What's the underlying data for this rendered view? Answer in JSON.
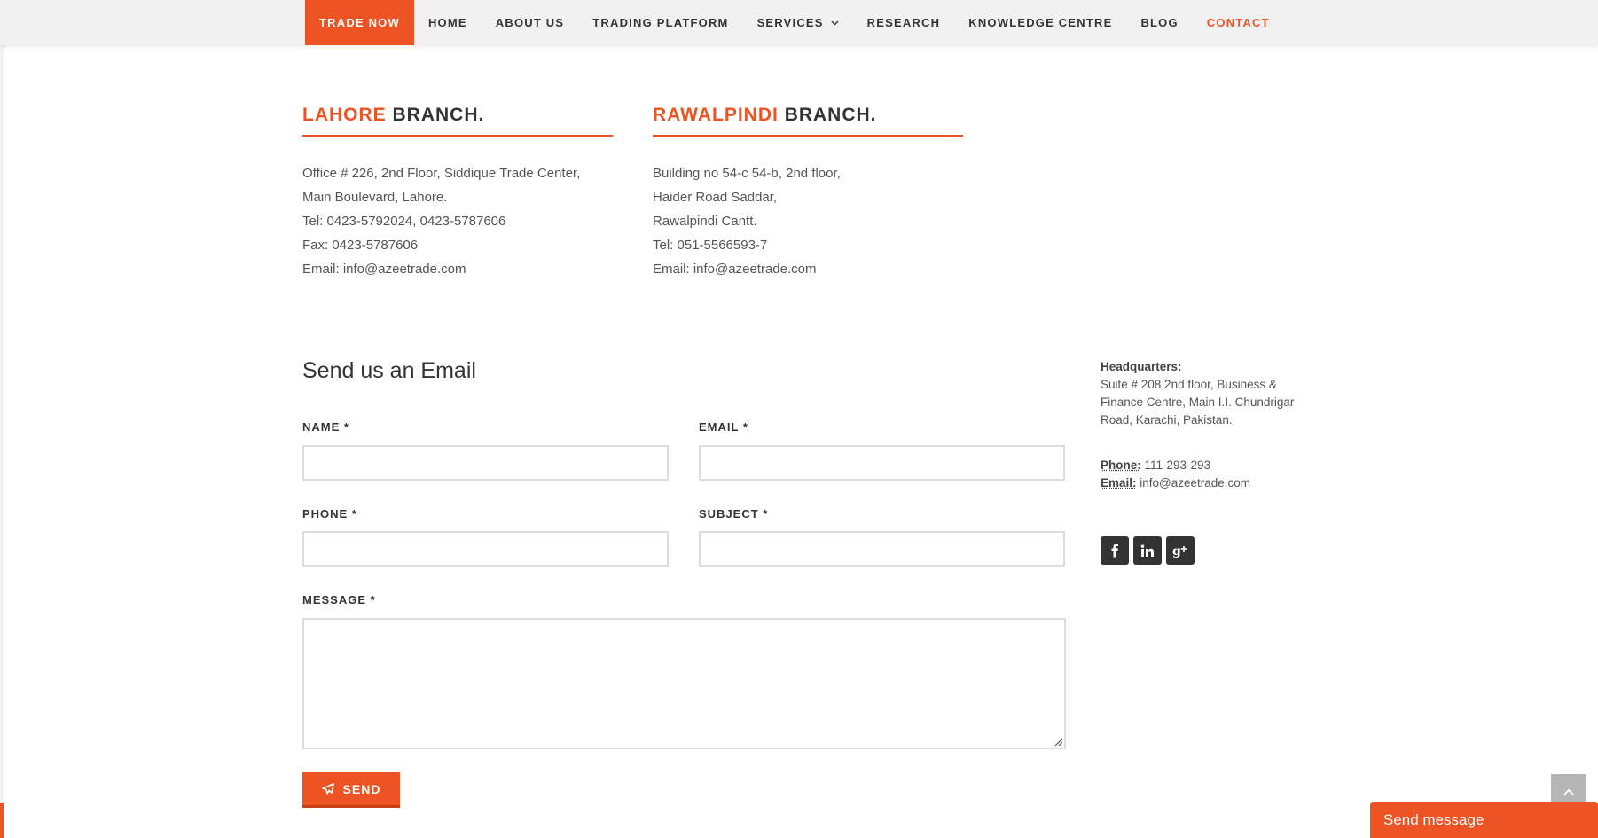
{
  "nav": {
    "items": [
      {
        "label": "TRADE NOW"
      },
      {
        "label": "HOME"
      },
      {
        "label": "ABOUT US"
      },
      {
        "label": "TRADING PLATFORM"
      },
      {
        "label": "SERVICES"
      },
      {
        "label": "RESEARCH"
      },
      {
        "label": "KNOWLEDGE CENTRE"
      },
      {
        "label": "BLOG"
      },
      {
        "label": "CONTACT"
      }
    ],
    "chevron": "chevron-down-icon"
  },
  "branches": [
    {
      "city": "LAHORE",
      "suffix": "BRANCH.",
      "lines": [
        "Office # 226, 2nd Floor, Siddique Trade Center,",
        "Main Boulevard, Lahore.",
        "Tel: 0423-5792024, 0423-5787606",
        "Fax: 0423-5787606",
        "Email: info@azeetrade.com"
      ]
    },
    {
      "city": "RAWALPINDI",
      "suffix": "BRANCH.",
      "lines": [
        "Building no 54-c 54-b, 2nd floor,",
        "Haider Road Saddar,",
        "Rawalpindi Cantt.",
        "Tel: 051-5566593-7",
        "Email: info@azeetrade.com"
      ]
    }
  ],
  "form": {
    "title": "Send us an Email",
    "name_label": "NAME *",
    "email_label": "EMAIL *",
    "phone_label": "PHONE *",
    "subject_label": "SUBJECT *",
    "message_label": "MESSAGE *",
    "name_value": "",
    "email_value": "",
    "phone_value": "",
    "subject_value": "",
    "message_value": "",
    "send_label": "SEND"
  },
  "hq": {
    "heading": "Headquarters:",
    "address": "Suite # 208 2nd floor, Business & Finance Centre, Main I.I. Chundrigar Road, Karachi, Pakistan.",
    "phone_label": "Phone:",
    "phone": "111-293-293",
    "email_label": "Email:",
    "email": "info@azeetrade.com"
  },
  "social": [
    {
      "icon": "facebook-icon",
      "glyph": "f"
    },
    {
      "icon": "linkedin-icon",
      "glyph": "in"
    },
    {
      "icon": "google-plus-icon",
      "glyph": "g+"
    }
  ],
  "chat": {
    "label": "Send message"
  },
  "colors": {
    "accent": "#ee5423",
    "dark": "#333333",
    "text": "#555555"
  }
}
